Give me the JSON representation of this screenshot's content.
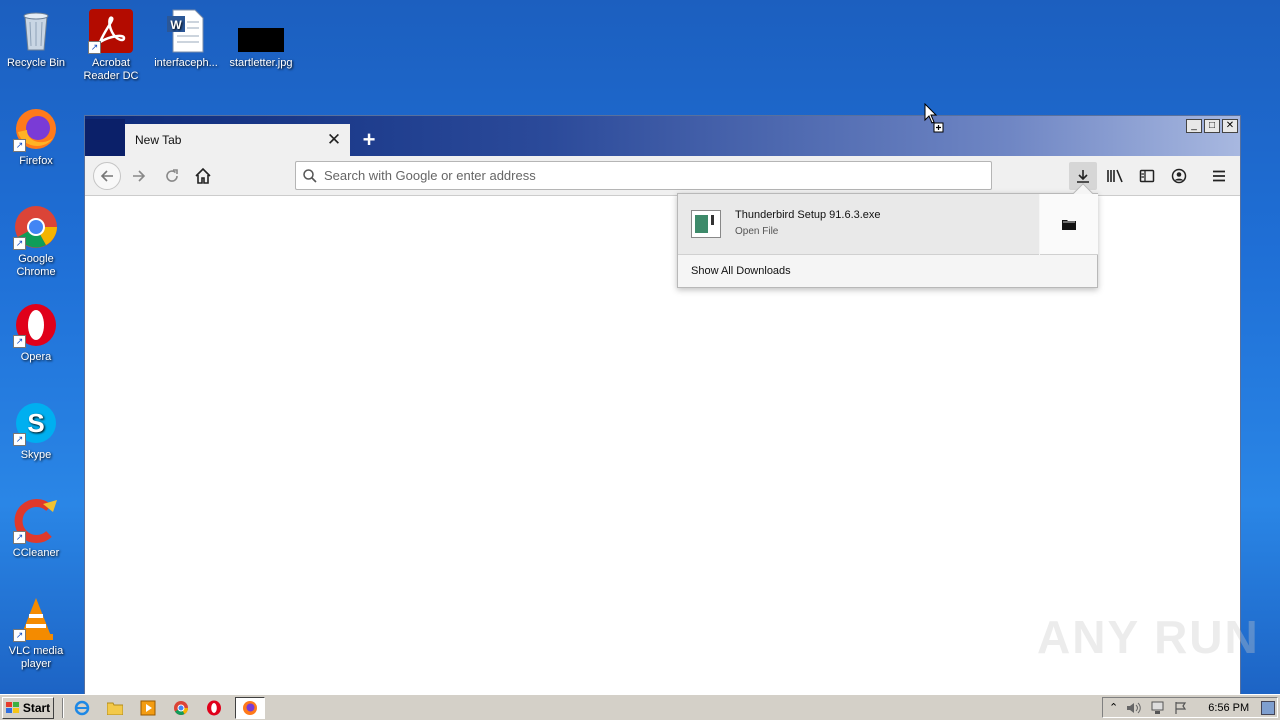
{
  "desktop": {
    "icons": [
      {
        "label": "Recycle Bin"
      },
      {
        "label": "Acrobat Reader DC"
      },
      {
        "label": "interfaceph..."
      },
      {
        "label": "startletter.jpg"
      },
      {
        "label": "Firefox"
      },
      {
        "label": "Google Chrome"
      },
      {
        "label": "Opera"
      },
      {
        "label": "Skype"
      },
      {
        "label": "CCleaner"
      },
      {
        "label": "VLC media player"
      }
    ]
  },
  "browser": {
    "tab_title": "New Tab",
    "tab_close": "✕",
    "new_tab": "+",
    "search_placeholder": "Search with Google or enter address",
    "window_controls": {
      "minimize": "_",
      "maximize": "□",
      "close": "✕"
    }
  },
  "downloads": {
    "file_name": "Thunderbird Setup 91.6.3.exe",
    "status": "Open File",
    "show_all": "Show All Downloads"
  },
  "watermark": "ANY RUN",
  "taskbar": {
    "start_label": "Start",
    "clock": "6:56 PM"
  }
}
